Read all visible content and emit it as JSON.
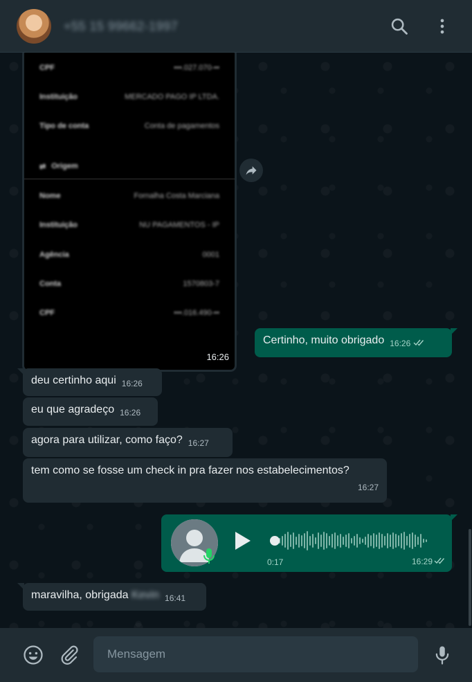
{
  "header": {
    "contact_name": "+55 15 99662-1997",
    "icons": [
      "search-icon",
      "menu-dots-icon"
    ]
  },
  "receipt": {
    "rows_top": [
      {
        "key": "CPF",
        "value": "•••.027.070-••"
      },
      {
        "key": "Instituição",
        "value": "MERCADO PAGO IP LTDA."
      },
      {
        "key": "Tipo de conta",
        "value": "Conta de pagamentos"
      }
    ],
    "origin_label": "Origem",
    "rows_bottom": [
      {
        "key": "Nome",
        "value": "Fornalha Costa Marciana"
      },
      {
        "key": "Instituição",
        "value": "NU PAGAMENTOS - IP"
      },
      {
        "key": "Agência",
        "value": "0001"
      },
      {
        "key": "Conta",
        "value": "1570803-7"
      },
      {
        "key": "CPF",
        "value": "•••.016.490-••"
      }
    ],
    "time": "16:26"
  },
  "messages": [
    {
      "dir": "out",
      "text": "Certinho, muito obrigado",
      "time": "16:26"
    },
    {
      "dir": "in",
      "text": "deu certinho aqui",
      "time": "16:26"
    },
    {
      "dir": "in",
      "text": "eu que agradeço",
      "time": "16:26"
    },
    {
      "dir": "in",
      "text": "agora para utilizar, como faço?",
      "time": "16:27"
    },
    {
      "dir": "in",
      "text": "tem como se fosse um check in pra fazer nos estabelecimentos?",
      "time": "16:27"
    },
    {
      "dir": "in",
      "text": "maravilha, obrigada",
      "blurred": "Kevin",
      "time": "16:41"
    }
  ],
  "voice": {
    "duration": "0:17",
    "time": "16:29"
  },
  "footer": {
    "placeholder": "Mensagem",
    "icons": [
      "emoji-icon",
      "attach-icon",
      "mic-icon"
    ]
  },
  "colors": {
    "header": "#202c33",
    "background": "#0b141a",
    "outgoing": "#005c4b",
    "incoming": "#202c33"
  }
}
